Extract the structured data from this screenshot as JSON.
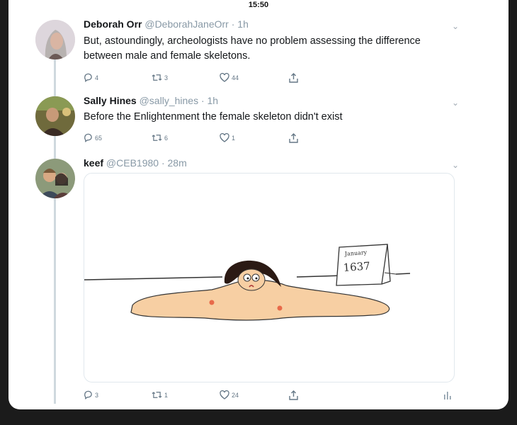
{
  "status_bar": {
    "time": "15:50"
  },
  "tweets": [
    {
      "name": "Deborah Orr",
      "handle": "@DeborahJaneOrr",
      "time": "· 1h",
      "text": "But, astoundingly, archeologists have no problem assessing the difference between male and female skeletons.",
      "replies": "4",
      "retweets": "3",
      "likes": "44",
      "avatar_icon": "woman-grey-hair-avatar"
    },
    {
      "name": "Sally Hines",
      "handle": "@sally_hines",
      "time": "· 1h",
      "text": "Before the Enlightenment the female skeleton didn't exist",
      "replies": "65",
      "retweets": "6",
      "likes": "1",
      "avatar_icon": "person-avatar"
    },
    {
      "name": "keef",
      "handle": "@CEB1980",
      "time": "· 28m",
      "text": "",
      "replies": "3",
      "retweets": "1",
      "likes": "24",
      "avatar_icon": "couple-avatar",
      "media": {
        "sign_text_top": "January",
        "sign_text_year": "1637"
      }
    }
  ],
  "colors": {
    "accent_gray": "#657786",
    "thread_line": "#cfd9de",
    "skin": "#f7cfa3"
  }
}
